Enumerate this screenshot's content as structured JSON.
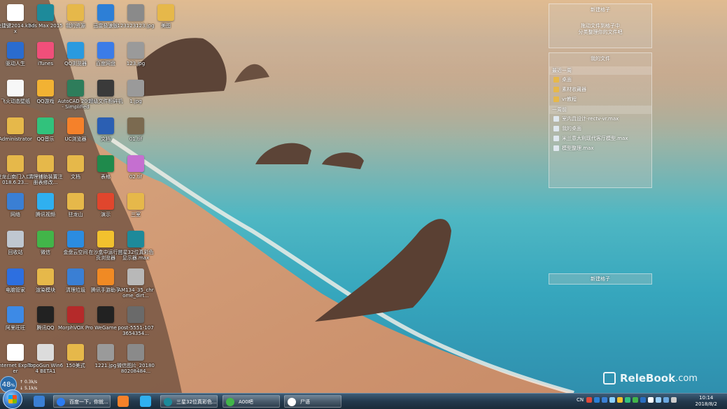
{
  "desktop": {
    "icons": [
      {
        "label": "快捷键2014.kbdx",
        "color": "#ffffff",
        "col": 0,
        "row": 0
      },
      {
        "label": "3ds Max 2015",
        "color": "#1d8a9a",
        "col": 1,
        "row": 0
      },
      {
        "label": "我的资源",
        "color": "#e6b84a",
        "col": 2,
        "row": 0
      },
      {
        "label": "迅雷极速版",
        "color": "#2d7fd6",
        "col": 3,
        "row": 0
      },
      {
        "label": "123123123.jpg",
        "color": "#8a8a8a",
        "col": 4,
        "row": 0
      },
      {
        "label": "美图",
        "color": "#e6b84a",
        "col": 5,
        "row": 0
      },
      {
        "label": "驱动人生",
        "color": "#2a6ccf",
        "col": 0,
        "row": 1
      },
      {
        "label": "iTunes",
        "color": "#f04f7a",
        "col": 1,
        "row": 1
      },
      {
        "label": "QQ浏览器",
        "color": "#2a9ae0",
        "col": 2,
        "row": 1
      },
      {
        "label": "百度网盘",
        "color": "#3b7ce8",
        "col": 3,
        "row": 1
      },
      {
        "label": "123.jpg",
        "color": "#9a9a9a",
        "col": 4,
        "row": 1
      },
      {
        "label": "飞火动态壁纸",
        "color": "#f7f7f7",
        "col": 0,
        "row": 2
      },
      {
        "label": "QQ游戏",
        "color": "#f2b233",
        "col": 1,
        "row": 2
      },
      {
        "label": "AutoCAD 2007 - Simplified",
        "color": "#2e7d5b",
        "col": 2,
        "row": 2
      },
      {
        "label": "超级文件粉碎机",
        "color": "#3a3a3a",
        "col": 3,
        "row": 2
      },
      {
        "label": "1.jpg",
        "color": "#9a9a9a",
        "col": 4,
        "row": 2
      },
      {
        "label": "Administrator",
        "color": "#e6b84a",
        "col": 0,
        "row": 3
      },
      {
        "label": "QQ音乐",
        "color": "#31c27c",
        "col": 1,
        "row": 3
      },
      {
        "label": "UC浏览器",
        "color": "#f5812a",
        "col": 2,
        "row": 3
      },
      {
        "label": "文档",
        "color": "#2b5fb3",
        "col": 3,
        "row": 3
      },
      {
        "label": "01.tif",
        "color": "#7b6a50",
        "col": 4,
        "row": 3
      },
      {
        "label": "驻龙山南门入口2018.6.23...",
        "color": "#e6b84a",
        "col": 0,
        "row": 4
      },
      {
        "label": "清理辅助装置注册表修改...",
        "color": "#e6b84a",
        "col": 1,
        "row": 4
      },
      {
        "label": "文档",
        "color": "#e6b84a",
        "col": 2,
        "row": 4
      },
      {
        "label": "表格",
        "color": "#1f8a4c",
        "col": 3,
        "row": 4
      },
      {
        "label": "02.tif",
        "color": "#c56fd0",
        "col": 4,
        "row": 4
      },
      {
        "label": "网络",
        "color": "#3a7fd4",
        "col": 0,
        "row": 5
      },
      {
        "label": "腾讯视频",
        "color": "#2fb0f0",
        "col": 1,
        "row": 5
      },
      {
        "label": "驻龙山",
        "color": "#e6b84a",
        "col": 2,
        "row": 5
      },
      {
        "label": "演示",
        "color": "#e0462d",
        "col": 3,
        "row": 5
      },
      {
        "label": "三室",
        "color": "#e6b84a",
        "col": 4,
        "row": 5
      },
      {
        "label": "回收站",
        "color": "#bfc7d0",
        "col": 0,
        "row": 6
      },
      {
        "label": "微信",
        "color": "#42b549",
        "col": 1,
        "row": 6
      },
      {
        "label": "金盘云空间",
        "color": "#2b8ce0",
        "col": 2,
        "row": 6
      },
      {
        "label": "在沙盒中运行网页浏览器",
        "color": "#f2c12e",
        "col": 3,
        "row": 6
      },
      {
        "label": "三星32位真彩色显示器.max",
        "color": "#1d8a9a",
        "col": 4,
        "row": 6
      },
      {
        "label": "电脑管家",
        "color": "#2d6fe0",
        "col": 0,
        "row": 7
      },
      {
        "label": "渲染模块",
        "color": "#e6b84a",
        "col": 1,
        "row": 7
      },
      {
        "label": "清理垃圾",
        "color": "#3a7fd4",
        "col": 2,
        "row": 7
      },
      {
        "label": "腾讯手游助手",
        "color": "#f08a24",
        "col": 3,
        "row": 7
      },
      {
        "label": "AM134_35_chrome_dirt...",
        "color": "#b8b8b8",
        "col": 4,
        "row": 7
      },
      {
        "label": "阿里旺旺",
        "color": "#3d8ae6",
        "col": 0,
        "row": 8
      },
      {
        "label": "腾讯QQ",
        "color": "#222222",
        "col": 1,
        "row": 8
      },
      {
        "label": "MorphVOX Pro",
        "color": "#b52a2a",
        "col": 2,
        "row": 8
      },
      {
        "label": "WeGame",
        "color": "#222222",
        "col": 3,
        "row": 8
      },
      {
        "label": "post-5551-1073654354...",
        "color": "#6a6a6a",
        "col": 4,
        "row": 8
      },
      {
        "label": "Internet Explorer",
        "color": "#ffffff",
        "col": 0,
        "row": 9
      },
      {
        "label": "TopoGun Win64 BETA1",
        "color": "#dcdcdc",
        "col": 1,
        "row": 9
      },
      {
        "label": "150美式",
        "color": "#e6b84a",
        "col": 2,
        "row": 9
      },
      {
        "label": "1221.jpg",
        "color": "#9a9a9a",
        "col": 3,
        "row": 9
      },
      {
        "label": "微信图片_2018080208484...",
        "color": "#8a8a8a",
        "col": 4,
        "row": 9
      }
    ]
  },
  "panels": {
    "top": {
      "title": "新建格子",
      "line1": "拖动文件到格子中",
      "line2": "分类整理你的文件吧"
    },
    "files": {
      "title": "我的文件",
      "section1": "最近一周",
      "recent": [
        "桌面",
        "素材收藏器",
        "vr教程"
      ],
      "section2": "一周前",
      "older": [
        "室内具设计-rectv-vr.max",
        "我的桌面",
        "米兰意大利现代客厅模型.max",
        "模型整理.max"
      ]
    },
    "bottom": {
      "title": "新建格子"
    }
  },
  "watermark": {
    "brand": "ReleBook",
    "suffix": ".com"
  },
  "taskbar": {
    "buttons": [
      {
        "label": "百度一下，你就...",
        "color": "#2c7cf2"
      },
      {
        "label": "三星32位真彩色...",
        "color": "#1d8a9a"
      },
      {
        "label": "A00吧",
        "color": "#42b549"
      },
      {
        "label": "尸语",
        "color": "#ffffff"
      }
    ],
    "cpu": "48",
    "cpu_unit": "%",
    "net_up": "0.3k/s",
    "net_down": "5.1k/s",
    "tray_text": "CN",
    "time": "10:14",
    "date": "2018/8/2"
  }
}
